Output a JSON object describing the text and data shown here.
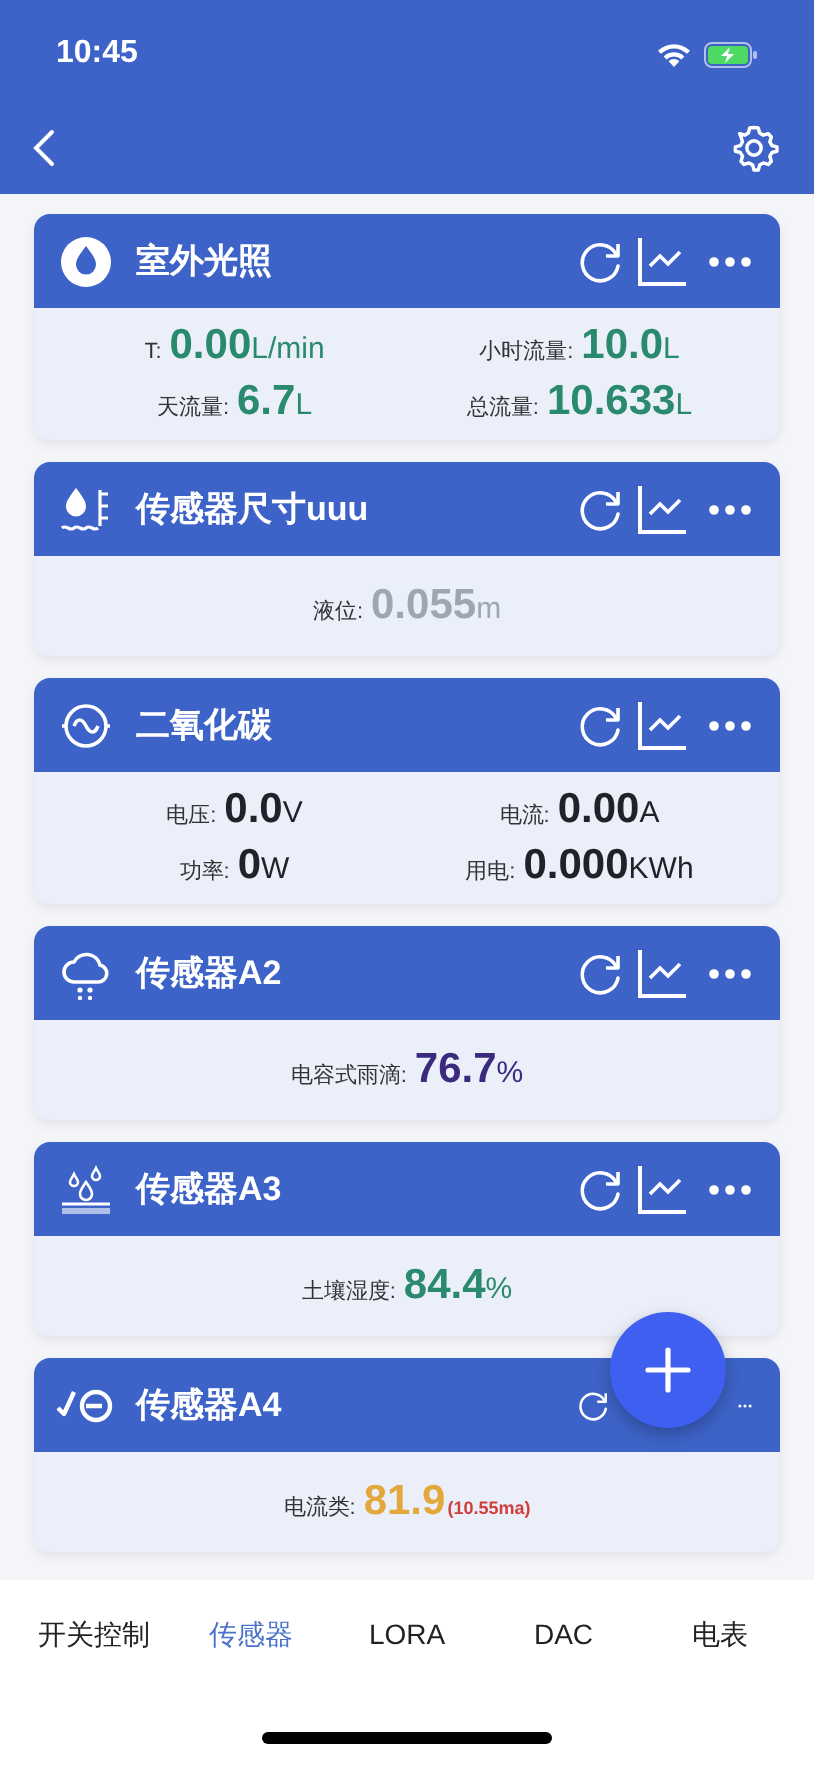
{
  "status_bar": {
    "time": "10:45"
  },
  "cards": [
    {
      "title": "室外光照",
      "readings": [
        {
          "label": "T:",
          "value": "0.00",
          "unit": "L/min",
          "color": "#2a8a6e"
        },
        {
          "label": "小时流量:",
          "value": "10.0",
          "unit": "L",
          "color": "#2a8a6e"
        },
        {
          "label": "天流量:",
          "value": "6.7",
          "unit": "L",
          "color": "#2a8a6e"
        },
        {
          "label": "总流量:",
          "value": "10.633",
          "unit": "L",
          "color": "#2a8a6e"
        }
      ]
    },
    {
      "title": "传感器尺寸uuu",
      "readings": [
        {
          "label": "液位:",
          "value": "0.055",
          "unit": "m",
          "color": "#9ea6b4"
        }
      ]
    },
    {
      "title": "二氧化碳",
      "readings": [
        {
          "label": "电压:",
          "value": "0.0",
          "unit": "V",
          "color": "#1f2329"
        },
        {
          "label": "电流:",
          "value": "0.00",
          "unit": "A",
          "color": "#1f2329"
        },
        {
          "label": "功率:",
          "value": "0",
          "unit": "W",
          "color": "#1f2329"
        },
        {
          "label": "用电:",
          "value": "0.000",
          "unit": "KWh",
          "color": "#1f2329"
        }
      ]
    },
    {
      "title": "传感器A2",
      "readings": [
        {
          "label": "电容式雨滴:",
          "value": "76.7",
          "unit": "%",
          "color": "#3b2a7e"
        }
      ]
    },
    {
      "title": "传感器A3",
      "readings": [
        {
          "label": "土壤湿度:",
          "value": "84.4",
          "unit": "%",
          "color": "#2a8a6e"
        }
      ]
    },
    {
      "title": "传感器A4",
      "readings": [
        {
          "label": "电流类:",
          "value": "81.9",
          "note": "(10.55ma)",
          "color": "#e2a83c"
        }
      ]
    }
  ],
  "tabs": [
    {
      "label": "开关控制",
      "selected": false
    },
    {
      "label": "传感器",
      "selected": true
    },
    {
      "label": "LORA",
      "selected": false
    },
    {
      "label": "DAC",
      "selected": false
    },
    {
      "label": "电表",
      "selected": false
    }
  ]
}
